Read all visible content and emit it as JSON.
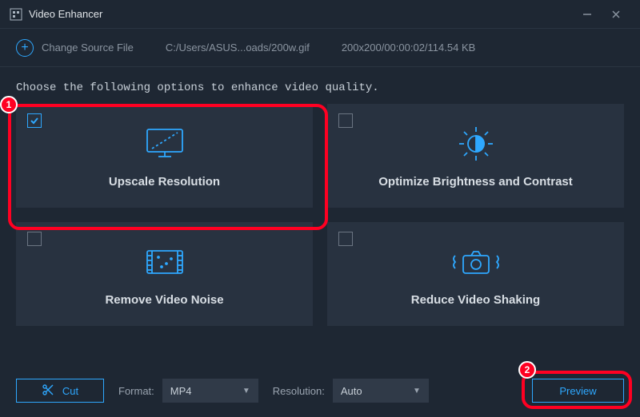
{
  "window": {
    "title": "Video Enhancer"
  },
  "toolbar": {
    "change_source": "Change Source File",
    "path": "C:/Users/ASUS...oads/200w.gif",
    "meta": "200x200/00:00:02/114.54 KB"
  },
  "prompt": "Choose the following options to enhance video quality.",
  "cards": {
    "upscale": {
      "label": "Upscale Resolution",
      "selected": true
    },
    "optimize": {
      "label": "Optimize Brightness and Contrast",
      "selected": false
    },
    "denoise": {
      "label": "Remove Video Noise",
      "selected": false
    },
    "deshake": {
      "label": "Reduce Video Shaking",
      "selected": false
    }
  },
  "bottom": {
    "cut": "Cut",
    "format_label": "Format:",
    "format_value": "MP4",
    "resolution_label": "Resolution:",
    "resolution_value": "Auto",
    "preview": "Preview"
  },
  "annotations": {
    "one": "1",
    "two": "2"
  }
}
